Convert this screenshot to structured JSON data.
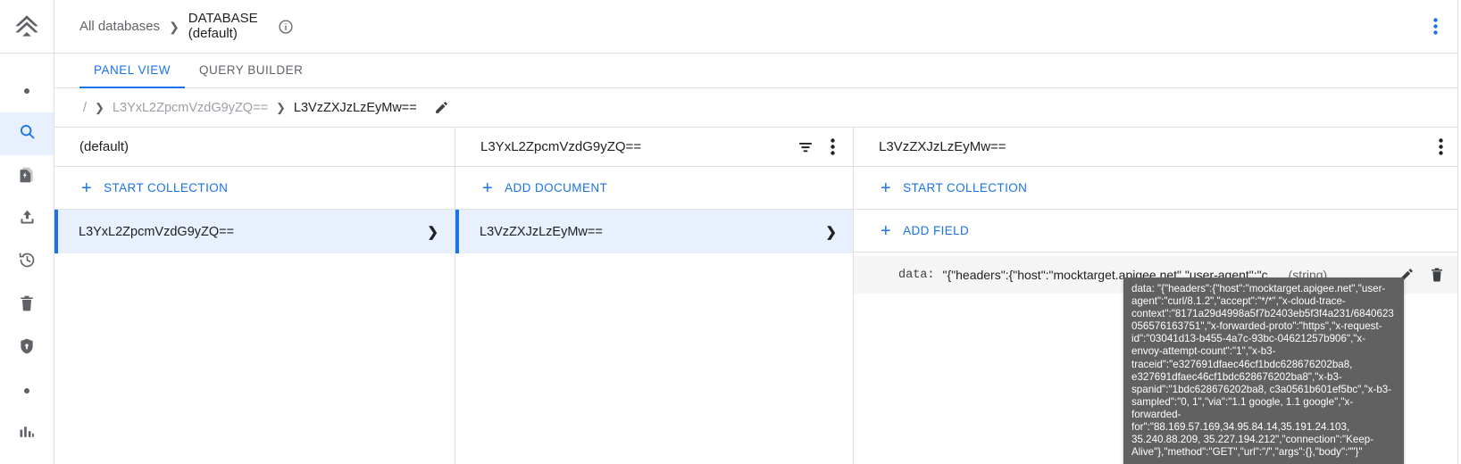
{
  "rail": {
    "logo_icon": "firebase-logo-icon",
    "items": [
      {
        "icon": "dot-icon",
        "name": "rail-item-dot-top",
        "interactable": false
      },
      {
        "icon": "search-icon",
        "name": "rail-item-search",
        "active": true
      },
      {
        "icon": "functions-icon",
        "name": "rail-item-functions",
        "active": false
      },
      {
        "icon": "upload-icon",
        "name": "rail-item-upload",
        "active": false
      },
      {
        "icon": "history-icon",
        "name": "rail-item-history",
        "active": false
      },
      {
        "icon": "trash-icon",
        "name": "rail-item-trash",
        "active": false
      },
      {
        "icon": "shield-icon",
        "name": "rail-item-security",
        "active": false
      },
      {
        "icon": "dot-icon",
        "name": "rail-item-dot-bottom",
        "interactable": false
      },
      {
        "icon": "chart-icon",
        "name": "rail-item-usage",
        "active": false
      }
    ]
  },
  "topbar": {
    "all_databases": "All databases",
    "chevron": "❯",
    "database_line1": "DATABASE",
    "database_line2": "(default)",
    "info_icon": "info-icon",
    "kebab_icon": "more-vert-icon"
  },
  "tabs": [
    {
      "label": "PANEL VIEW",
      "active": true
    },
    {
      "label": "QUERY BUILDER",
      "active": false
    }
  ],
  "path": {
    "root": "/",
    "chevron": "❯",
    "segments": [
      "L3YxL2ZpcmVzdG9yZQ==",
      "L3VzZXJzLzEyMw=="
    ],
    "edit_icon": "pencil-icon"
  },
  "panels": [
    {
      "title": "(default)",
      "title_bold": true,
      "actions": [
        {
          "label": "START COLLECTION",
          "icon": "plus-icon"
        }
      ],
      "rows": [
        {
          "label": "L3YxL2ZpcmVzdG9yZQ==",
          "selected": true,
          "chevron": "❯"
        }
      ],
      "head_icons": []
    },
    {
      "title": "L3YxL2ZpcmVzdG9yZQ==",
      "title_bold": false,
      "actions": [
        {
          "label": "ADD DOCUMENT",
          "icon": "plus-icon"
        }
      ],
      "rows": [
        {
          "label": "L3VzZXJzLzEyMw==",
          "selected": true,
          "chevron": "❯"
        }
      ],
      "head_icons": [
        "filter-icon",
        "more-vert-icon"
      ]
    },
    {
      "title": "L3VzZXJzLzEyMw==",
      "title_bold": false,
      "actions": [
        {
          "label": "START COLLECTION",
          "icon": "plus-icon"
        },
        {
          "label": "ADD FIELD",
          "icon": "plus-icon"
        }
      ],
      "rows": [],
      "head_icons": [
        "more-vert-icon"
      ]
    }
  ],
  "field": {
    "key": "data:",
    "value": "\"{\"headers\":{\"host\":\"mocktarget.apigee.net\",\"user-agent\":\"c…",
    "type": "(string)",
    "edit_icon": "pencil-icon",
    "delete_icon": "trash-icon"
  },
  "tooltip": {
    "text": "data: \"{\"headers\":{\"host\":\"mocktarget.apigee.net\",\"user-agent\":\"curl/8.1.2\",\"accept\":\"*/*\",\"x-cloud-trace-context\":\"8171a29d4998a5f7b2403eb5f3f4a231/6840623056576163751\",\"x-forwarded-proto\":\"https\",\"x-request-id\":\"03041d13-b455-4a7c-93bc-04621257b906\",\"x-envoy-attempt-count\":\"1\",\"x-b3-traceid\":\"e327691dfaec46cf1bdc628676202ba8, e327691dfaec46cf1bdc628676202ba8\",\"x-b3-spanid\":\"1bdc628676202ba8, c3a0561b601ef5bc\",\"x-b3-sampled\":\"0, 1\",\"via\":\"1.1 google, 1.1 google\",\"x-forwarded-for\":\"88.169.57.169,34.95.84.14,35.191.24.103, 35.240.88.209, 35.227.194.212\",\"connection\":\"Keep-Alive\"},\"method\":\"GET\",\"url\":\"/\",\"args\":{},\"body\":\"\"}\""
  },
  "colors": {
    "accent": "#1a73e8",
    "selected_bg": "#e8f0fe",
    "border": "#e0e0e0",
    "tooltip_bg": "#616161",
    "text_primary": "#202124",
    "text_secondary": "#5f6368"
  }
}
